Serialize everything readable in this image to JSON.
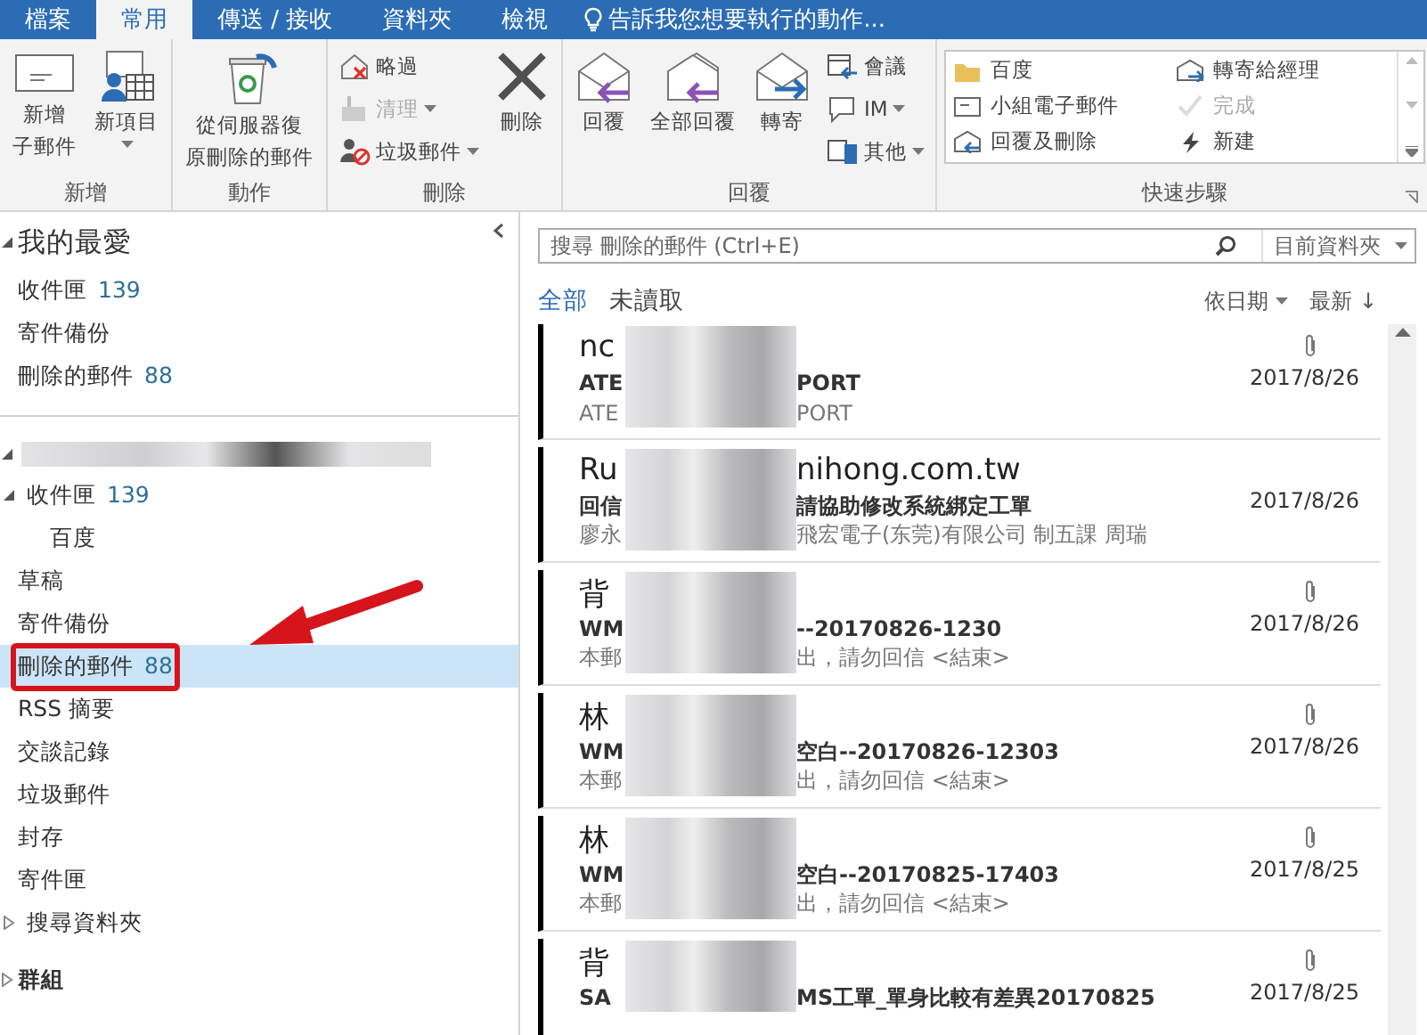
{
  "tabs": [
    {
      "label": "檔案",
      "selected": false
    },
    {
      "label": "常用",
      "selected": true
    },
    {
      "label": "傳送 / 接收",
      "selected": false
    },
    {
      "label": "資料夾",
      "selected": false
    },
    {
      "label": "檢視",
      "selected": false
    }
  ],
  "tell_me": "告訴我您想要執行的動作...",
  "ribbon": {
    "groups": [
      {
        "label": "新增",
        "items": [
          {
            "kind": "large",
            "lines": [
              "新增",
              "子郵件"
            ],
            "dropdown": false,
            "disabled": false
          },
          {
            "kind": "large",
            "lines": [
              "新項目"
            ],
            "dropdown": true,
            "disabled": false
          }
        ]
      },
      {
        "label": "動作",
        "items": [
          {
            "kind": "large",
            "lines": [
              "從伺服器復",
              "原刪除的郵件"
            ],
            "dropdown": false,
            "disabled": false
          }
        ]
      },
      {
        "label": "刪除",
        "items": [
          {
            "kind": "small",
            "lines": [
              "略過"
            ],
            "dropdown": false,
            "disabled": false
          },
          {
            "kind": "small",
            "lines": [
              "清理"
            ],
            "dropdown": true,
            "disabled": true
          },
          {
            "kind": "small",
            "lines": [
              "垃圾郵件"
            ],
            "dropdown": true,
            "disabled": false
          },
          {
            "kind": "large",
            "lines": [
              "刪除"
            ],
            "dropdown": false,
            "disabled": false
          }
        ]
      },
      {
        "label": "回覆",
        "items": [
          {
            "kind": "large",
            "lines": [
              "回覆"
            ],
            "dropdown": false,
            "disabled": false
          },
          {
            "kind": "large",
            "lines": [
              "全部回覆"
            ],
            "dropdown": false,
            "disabled": false
          },
          {
            "kind": "large",
            "lines": [
              "轉寄"
            ],
            "dropdown": false,
            "disabled": false
          },
          {
            "kind": "small",
            "lines": [
              "會議"
            ],
            "dropdown": false,
            "disabled": false
          },
          {
            "kind": "small",
            "lines": [
              "IM"
            ],
            "dropdown": true,
            "disabled": false
          },
          {
            "kind": "small",
            "lines": [
              "其他"
            ],
            "dropdown": true,
            "disabled": false
          }
        ]
      },
      {
        "label": "快速步驟",
        "items": [
          {
            "kind": "gallery",
            "lines": [
              "百度"
            ],
            "disabled": false
          },
          {
            "kind": "gallery",
            "lines": [
              "轉寄給經理"
            ],
            "disabled": false
          },
          {
            "kind": "gallery",
            "lines": [
              "小組電子郵件"
            ],
            "disabled": false
          },
          {
            "kind": "gallery",
            "lines": [
              "完成"
            ],
            "disabled": true
          },
          {
            "kind": "gallery",
            "lines": [
              "回覆及刪除"
            ],
            "disabled": false
          },
          {
            "kind": "gallery",
            "lines": [
              "新建"
            ],
            "disabled": false
          }
        ]
      }
    ]
  },
  "nav": {
    "favorites": {
      "title": "我的最愛",
      "expanded": true,
      "items": [
        {
          "label": "收件匣",
          "count": "139",
          "selected": false
        },
        {
          "label": "寄件備份",
          "selected": false
        },
        {
          "label": "刪除的郵件",
          "count": "88",
          "selected": false
        }
      ]
    },
    "account": {
      "expanded": true,
      "folders": [
        {
          "label": "收件匣",
          "count": "139",
          "selected": false,
          "expanded": true,
          "children": [
            {
              "label": "百度",
              "selected": false
            }
          ]
        },
        {
          "label": "草稿",
          "selected": false
        },
        {
          "label": "寄件備份",
          "selected": false
        },
        {
          "label": "刪除的郵件",
          "count": "88",
          "selected": true,
          "annotated": true
        },
        {
          "label": "RSS 摘要",
          "selected": false
        },
        {
          "label": "交談記錄",
          "selected": false
        },
        {
          "label": "垃圾郵件",
          "selected": false
        },
        {
          "label": "封存",
          "selected": false
        },
        {
          "label": "寄件匣",
          "selected": false
        },
        {
          "label": "搜尋資料夾",
          "selected": false,
          "expanded": false
        }
      ]
    },
    "groups": {
      "title": "群組",
      "expanded": false
    }
  },
  "mail": {
    "search": {
      "placeholder": "搜尋 刪除的郵件 (Ctrl+E)",
      "scope": "目前資料夾"
    },
    "filters": [
      {
        "label": "全部",
        "selected": true
      },
      {
        "label": "未讀取",
        "selected": false
      }
    ],
    "sort": "依日期",
    "order": "最新 ↓",
    "messages": [
      {
        "sender": [
          "nc"
        ],
        "subject": [
          "ATE",
          "PORT"
        ],
        "preview": [
          "ATE",
          "PORT"
        ],
        "date": "2017/8/26",
        "attachment": true
      },
      {
        "sender": [
          "Ru",
          "nihong.com.tw"
        ],
        "subject": [
          "回信",
          "請協助修改系統綁定工單"
        ],
        "preview": [
          "廖永",
          "飛宏電子(东莞)有限公司 制五課 周瑞"
        ],
        "date": "2017/8/26",
        "attachment": false
      },
      {
        "sender": [
          "背"
        ],
        "subject": [
          "WM",
          "--20170826-1230"
        ],
        "preview": [
          "本郵",
          "出，請勿回信 <結束>"
        ],
        "date": "2017/8/26",
        "attachment": true
      },
      {
        "sender": [
          "林"
        ],
        "subject": [
          "WM",
          "空白--20170826-12303"
        ],
        "preview": [
          "本郵",
          "出，請勿回信 <結束>"
        ],
        "date": "2017/8/26",
        "attachment": true
      },
      {
        "sender": [
          "林"
        ],
        "subject": [
          "WM",
          "空白--20170825-17403"
        ],
        "preview": [
          "本郵",
          "出，請勿回信 <結束>"
        ],
        "date": "2017/8/25",
        "attachment": true
      },
      {
        "sender": [
          "背"
        ],
        "subject": [
          "SA",
          "MS工單_單身比較有差異20170825"
        ],
        "date": "2017/8/25",
        "attachment": true
      }
    ]
  }
}
